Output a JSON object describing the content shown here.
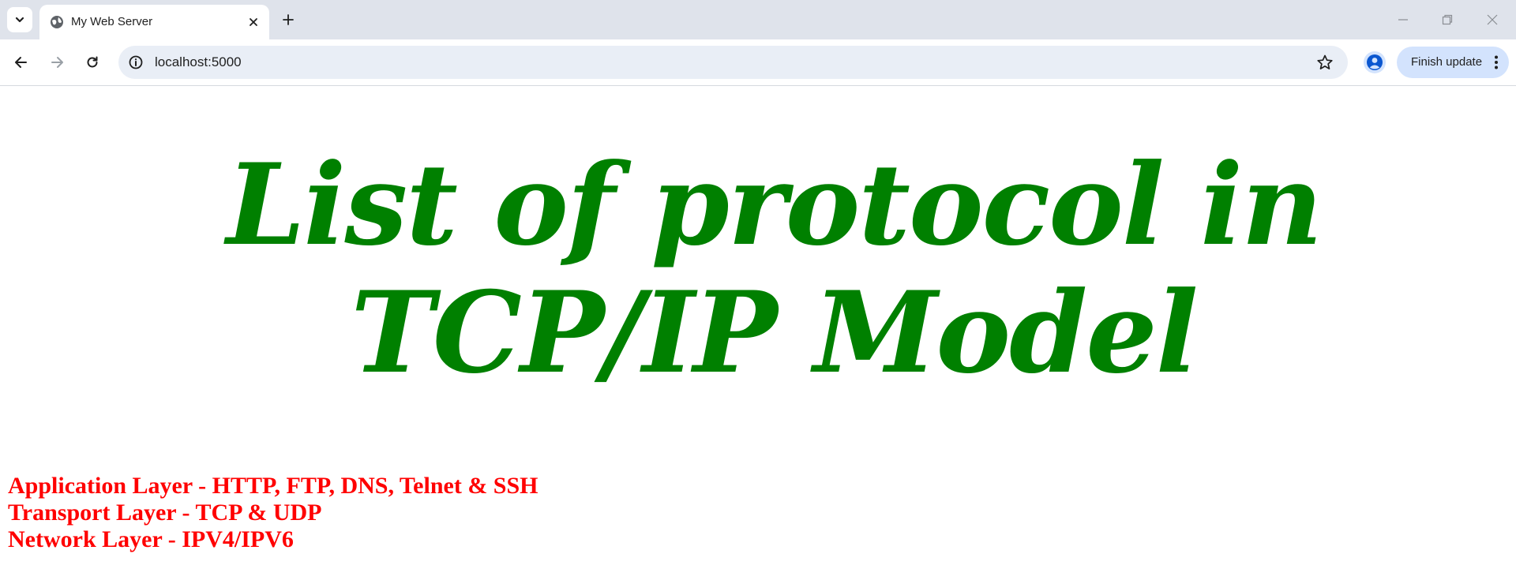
{
  "browser": {
    "tab": {
      "title": "My Web Server"
    },
    "address_bar": {
      "url": "localhost:5000"
    },
    "update_button": {
      "label": "Finish update"
    }
  },
  "page": {
    "heading": "List of protocol in TCP/IP Model",
    "heading_color": "#008000",
    "layers": [
      {
        "text": "Application Layer - HTTP, FTP, DNS, Telnet & SSH"
      },
      {
        "text": "Transport Layer - TCP & UDP"
      },
      {
        "text": "Network Layer - IPV4/IPV6"
      }
    ],
    "layers_color": "#ff0000"
  },
  "icons": {
    "tab_search": "chevron-down-icon",
    "favicon": "globe-icon",
    "tab_close": "close-icon",
    "new_tab": "plus-icon",
    "minimize": "minimize-icon",
    "restore": "restore-icon",
    "window_close": "close-icon",
    "back": "arrow-left-icon",
    "forward": "arrow-right-icon",
    "reload": "reload-icon",
    "site_info": "info-icon",
    "bookmark": "star-icon",
    "profile": "person-icon",
    "menu": "kebab-icon"
  }
}
